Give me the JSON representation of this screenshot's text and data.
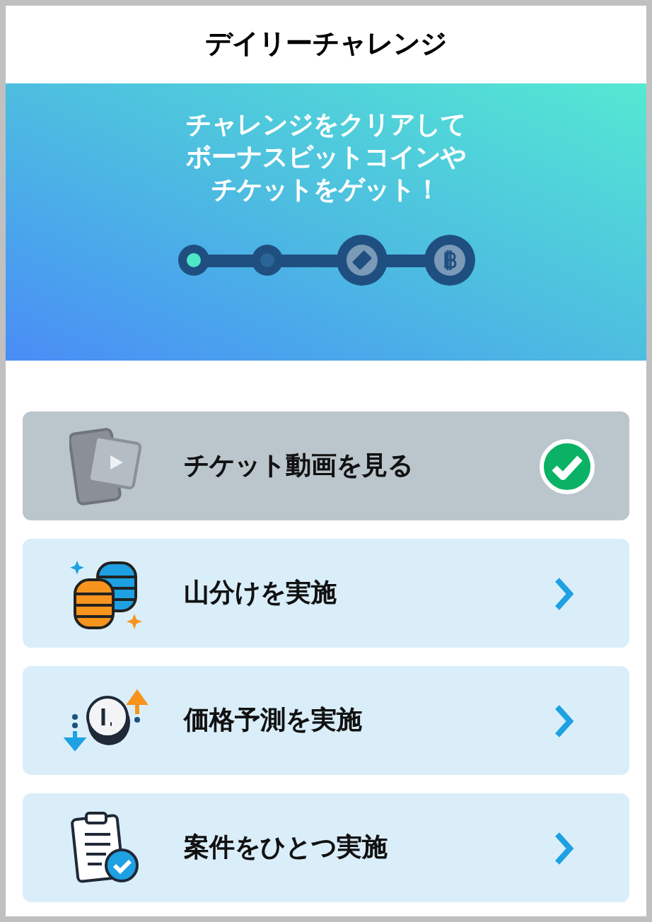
{
  "header": {
    "title": "デイリーチャレンジ"
  },
  "banner": {
    "lines": [
      "チャレンジをクリアして",
      "ボーナスビットコインや",
      "チケットをゲット！"
    ],
    "progress": [
      {
        "kind": "dot",
        "reached": true
      },
      {
        "kind": "dot",
        "reached": false
      },
      {
        "kind": "ticket",
        "reached": false
      },
      {
        "kind": "coin",
        "reached": false
      }
    ]
  },
  "challenges": [
    {
      "kind": "video",
      "label": "チケット動画を見る",
      "completed": true
    },
    {
      "kind": "coins",
      "label": "山分けを実施",
      "completed": false
    },
    {
      "kind": "prediction",
      "label": "価格予測を実施",
      "completed": false
    },
    {
      "kind": "clipboard",
      "label": "案件をひとつ実施",
      "completed": false
    }
  ]
}
